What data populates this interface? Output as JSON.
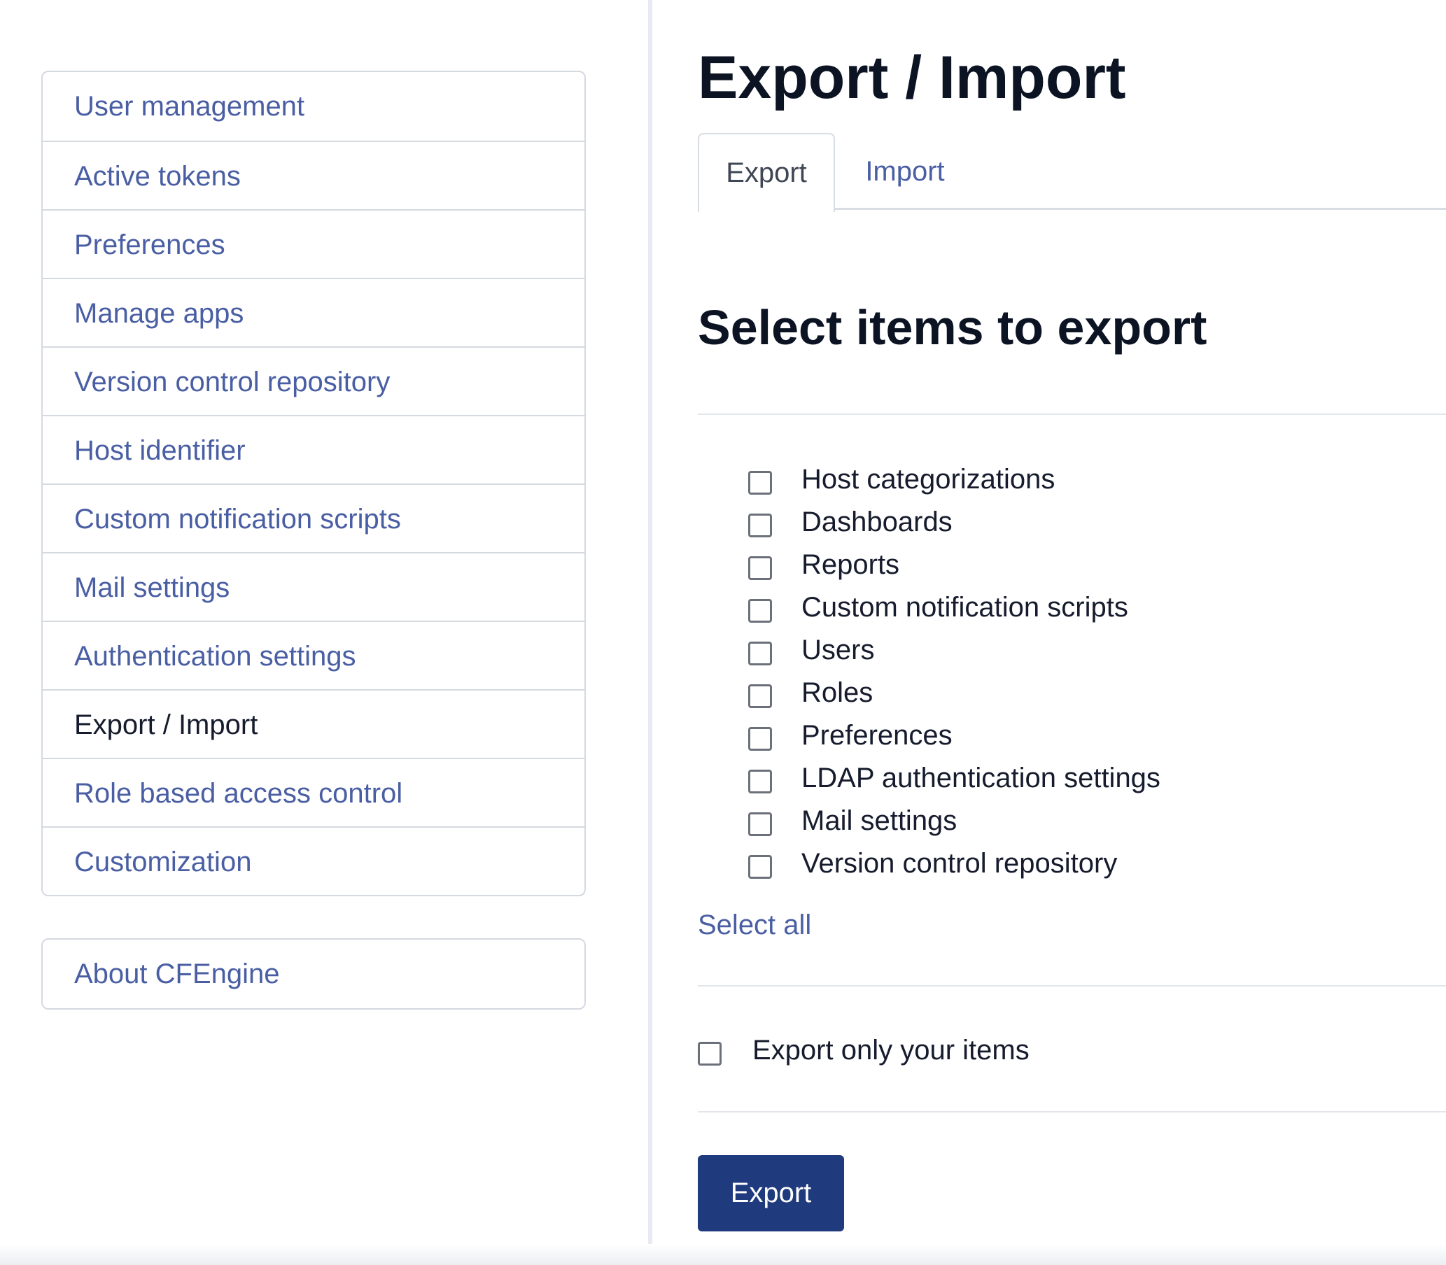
{
  "sidebar": {
    "items": [
      {
        "label": "User management"
      },
      {
        "label": "Active tokens"
      },
      {
        "label": "Preferences"
      },
      {
        "label": "Manage apps"
      },
      {
        "label": "Version control repository"
      },
      {
        "label": "Host identifier"
      },
      {
        "label": "Custom notification scripts"
      },
      {
        "label": "Mail settings"
      },
      {
        "label": "Authentication settings"
      },
      {
        "label": "Export / Import",
        "active": true
      },
      {
        "label": "Role based access control"
      },
      {
        "label": "Customization"
      }
    ],
    "about": {
      "label": "About CFEngine"
    }
  },
  "main": {
    "title": "Export / Import",
    "tabs": [
      {
        "label": "Export",
        "active": true
      },
      {
        "label": "Import",
        "active": false
      }
    ],
    "section_title": "Select items to export",
    "items": [
      {
        "label": "Host categorizations",
        "checked": false
      },
      {
        "label": "Dashboards",
        "checked": false
      },
      {
        "label": "Reports",
        "checked": false
      },
      {
        "label": "Custom notification scripts",
        "checked": false
      },
      {
        "label": "Users",
        "checked": false
      },
      {
        "label": "Roles",
        "checked": false
      },
      {
        "label": "Preferences",
        "checked": false
      },
      {
        "label": "LDAP authentication settings",
        "checked": false
      },
      {
        "label": "Mail settings",
        "checked": false
      },
      {
        "label": "Version control repository",
        "checked": false
      }
    ],
    "select_all_label": "Select all",
    "own_items_label": "Export only your items",
    "own_items_checked": false,
    "export_button_label": "Export"
  },
  "colors": {
    "link": "#4a5fa3",
    "text": "#161c2d",
    "heading": "#0c1424",
    "button": "#1f3a7d",
    "border": "#d5d9e0"
  }
}
